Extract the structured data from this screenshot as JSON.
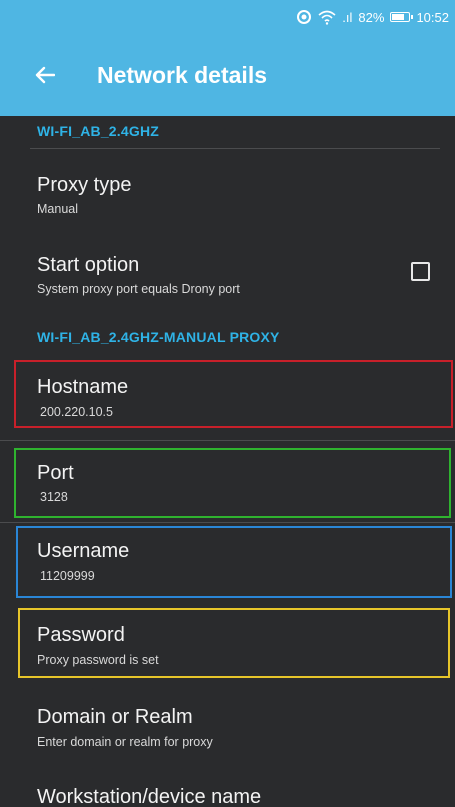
{
  "status_bar": {
    "battery": "82%",
    "battery_level": 0.82,
    "time": "10:52",
    "signal": ".ıl"
  },
  "app_bar": {
    "title": "Network details",
    "back_icon": "arrow-left-icon"
  },
  "sections": {
    "network_name": "WI-FI_AB_2.4GHZ",
    "proxy_section": "WI-FI_AB_2.4GHZ-MANUAL PROXY"
  },
  "settings": {
    "proxy_type": {
      "title": "Proxy type",
      "subtitle": "Manual"
    },
    "start_option": {
      "title": "Start option",
      "subtitle": "System proxy port equals Drony port",
      "checked": false
    },
    "hostname": {
      "title": "Hostname",
      "subtitle": "200.220.10.5"
    },
    "port": {
      "title": "Port",
      "subtitle": "3128"
    },
    "username": {
      "title": "Username",
      "subtitle": "11209999"
    },
    "password": {
      "title": "Password",
      "subtitle": "Proxy password is set"
    },
    "domain": {
      "title": "Domain or Realm",
      "subtitle": "Enter domain or realm for proxy"
    },
    "workstation": {
      "title": "Workstation/device name"
    }
  },
  "highlight_colors": {
    "hostname": "#c8202a",
    "port": "#2fb32f",
    "username": "#2a86d6",
    "password": "#e6c52a"
  }
}
